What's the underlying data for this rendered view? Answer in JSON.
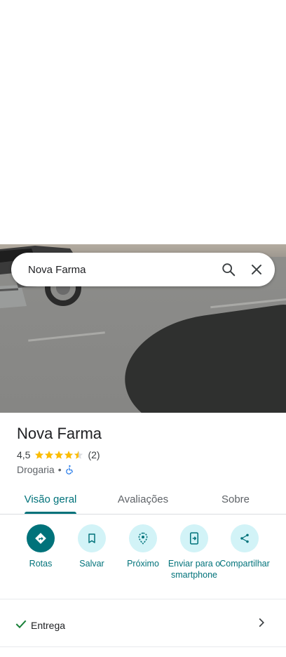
{
  "search": {
    "query": "Nova Farma"
  },
  "place": {
    "title": "Nova Farma",
    "rating": "4,5",
    "rating_value": 4.5,
    "reviews_count": "(2)",
    "category": "Drogaria",
    "separator": "•"
  },
  "tabs": [
    {
      "label": "Visão geral",
      "active": true
    },
    {
      "label": "Avaliações",
      "active": false
    },
    {
      "label": "Sobre",
      "active": false
    }
  ],
  "actions": [
    {
      "label": "Rotas",
      "icon": "directions-icon"
    },
    {
      "label": "Salvar",
      "icon": "bookmark-icon"
    },
    {
      "label": "Próximo",
      "icon": "nearby-icon"
    },
    {
      "label": "Enviar para o smartphone",
      "icon": "send-to-phone-icon"
    },
    {
      "label": "Compartilhar",
      "icon": "share-icon"
    }
  ],
  "delivery": {
    "label": "Entrega"
  },
  "colors": {
    "accent": "#00727a",
    "accent_light": "#d2f3f7",
    "star": "#fbbc04",
    "accessibility": "#1a73e8"
  }
}
